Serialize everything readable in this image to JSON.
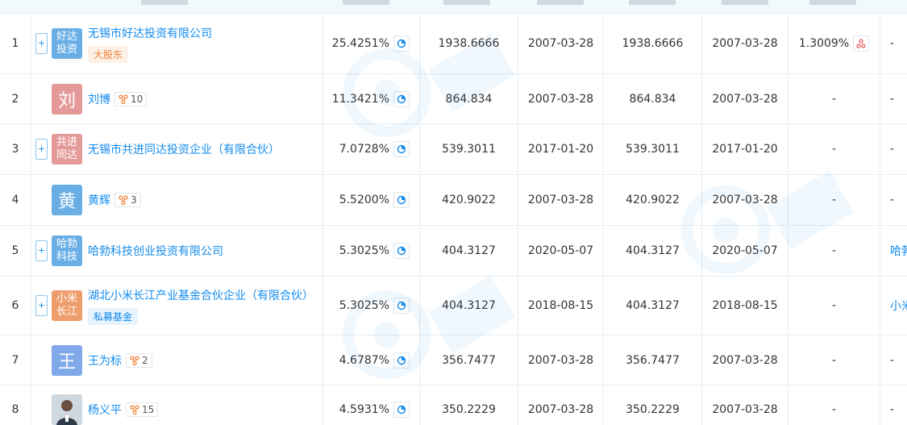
{
  "rows": [
    {
      "index": "1",
      "name": "无锡市好达投资有限公司",
      "avatar": {
        "text": "好达\n投资",
        "color": "#6aaee6",
        "kind": "company"
      },
      "expand": "+",
      "tag": {
        "text": "大股东",
        "style": "orange"
      },
      "ratio": "25.4251%",
      "sub_amount": "1938.6666",
      "sub_date": "2007-03-28",
      "paid_amount": "1938.6666",
      "paid_date": "2007-03-28",
      "ratio2": "1.3009%",
      "ratio2_icon": true,
      "last": "-"
    },
    {
      "index": "2",
      "name": "刘博",
      "avatar": {
        "text": "刘",
        "color": "#e59a9a",
        "kind": "person"
      },
      "relations": "10",
      "ratio": "11.3421%",
      "sub_amount": "864.834",
      "sub_date": "2007-03-28",
      "paid_amount": "864.834",
      "paid_date": "2007-03-28",
      "ratio2": "-",
      "last": "-"
    },
    {
      "index": "3",
      "name": "无锡市共进同达投资企业（有限合伙）",
      "avatar": {
        "text": "共进\n同达",
        "color": "#e59a9a",
        "kind": "company"
      },
      "expand": "+",
      "ratio": "7.0728%",
      "sub_amount": "539.3011",
      "sub_date": "2017-01-20",
      "paid_amount": "539.3011",
      "paid_date": "2017-01-20",
      "ratio2": "-",
      "last": "-"
    },
    {
      "index": "4",
      "name": "黄辉",
      "avatar": {
        "text": "黄",
        "color": "#6aaee6",
        "kind": "person"
      },
      "relations": "3",
      "ratio": "5.5200%",
      "sub_amount": "420.9022",
      "sub_date": "2007-03-28",
      "paid_amount": "420.9022",
      "paid_date": "2007-03-28",
      "ratio2": "-",
      "last": "-"
    },
    {
      "index": "5",
      "name": "哈勃科技创业投资有限公司",
      "avatar": {
        "text": "哈勃\n科技",
        "color": "#6aaee6",
        "kind": "company"
      },
      "expand": "+",
      "ratio": "5.3025%",
      "sub_amount": "404.3127",
      "sub_date": "2020-05-07",
      "paid_amount": "404.3127",
      "paid_date": "2020-05-07",
      "ratio2": "-",
      "last": "哈勃",
      "last_link": true
    },
    {
      "index": "6",
      "name": "湖北小米长江产业基金合伙企业（有限合伙）",
      "avatar": {
        "text": "小米\n长江",
        "color": "#ee9e6c",
        "kind": "company"
      },
      "expand": "+",
      "tag": {
        "text": "私募基金",
        "style": "blue"
      },
      "ratio": "5.3025%",
      "sub_amount": "404.3127",
      "sub_date": "2018-08-15",
      "paid_amount": "404.3127",
      "paid_date": "2018-08-15",
      "ratio2": "-",
      "last": "小米",
      "last_link": true
    },
    {
      "index": "7",
      "name": "王为标",
      "avatar": {
        "text": "王",
        "color": "#7fa9e8",
        "kind": "person"
      },
      "relations": "2",
      "ratio": "4.6787%",
      "sub_amount": "356.7477",
      "sub_date": "2007-03-28",
      "paid_amount": "356.7477",
      "paid_date": "2007-03-28",
      "ratio2": "-",
      "last": "-"
    },
    {
      "index": "8",
      "name": "杨义平",
      "avatar": {
        "text": "",
        "color": "#dde3e8",
        "kind": "photo"
      },
      "relations": "15",
      "ratio": "4.5931%",
      "sub_amount": "350.2229",
      "sub_date": "2007-03-28",
      "paid_amount": "350.2229",
      "paid_date": "2007-03-28",
      "ratio2": "-",
      "last": "-"
    }
  ]
}
